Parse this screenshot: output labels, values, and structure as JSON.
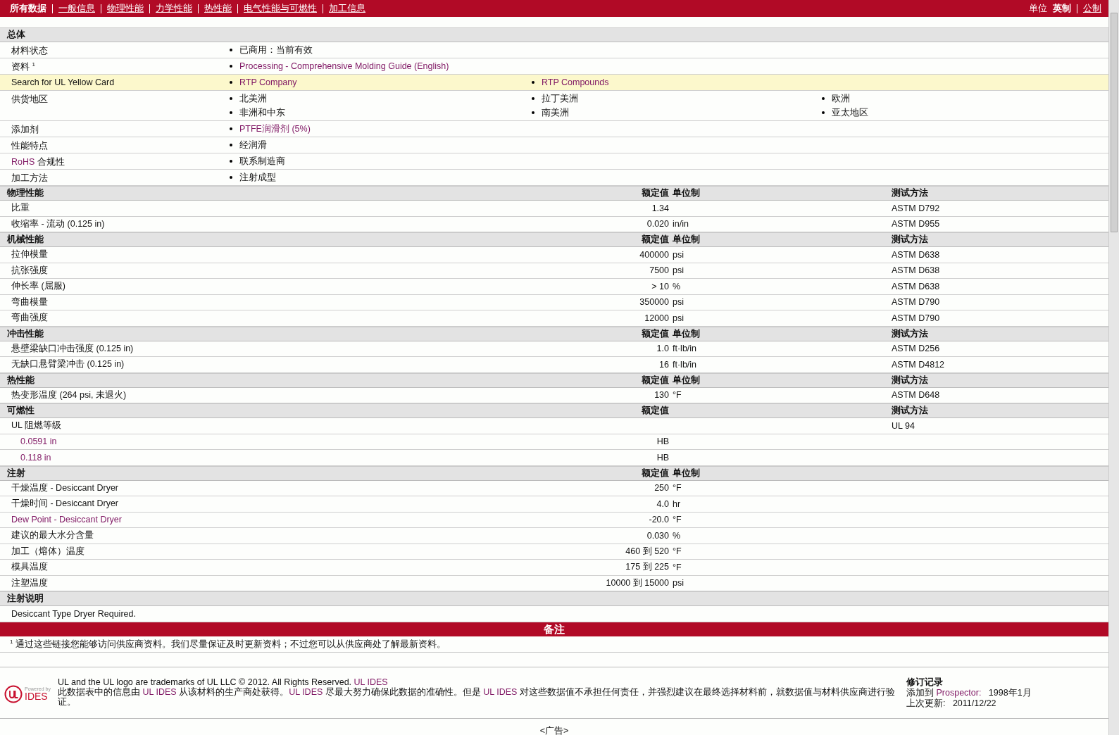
{
  "nav": {
    "tabs": [
      {
        "label": "所有数据",
        "selected": true
      },
      {
        "label": "一般信息",
        "selected": false
      },
      {
        "label": "物理性能",
        "selected": false
      },
      {
        "label": "力学性能",
        "selected": false
      },
      {
        "label": "热性能",
        "selected": false
      },
      {
        "label": "电气性能与可燃性",
        "selected": false
      },
      {
        "label": "加工信息",
        "selected": false
      }
    ],
    "units_label": "单位",
    "units": [
      {
        "label": "英制",
        "selected": true
      },
      {
        "label": "公制",
        "selected": false
      }
    ]
  },
  "general": {
    "title": "总体",
    "rows": [
      {
        "label": [
          {
            "text": "材料状态",
            "link": false
          }
        ],
        "highlighted": false,
        "items": [
          {
            "text": "已商用：当前有效",
            "link": false
          }
        ]
      },
      {
        "label": [
          {
            "text": "资料 $^{1}$",
            "link": false
          }
        ],
        "highlighted": false,
        "items": [
          {
            "text": "Processing - Comprehensive Molding Guide (English)",
            "link": true
          }
        ]
      },
      {
        "label": [
          {
            "text": "Search for UL Yellow Card",
            "link": false
          }
        ],
        "highlighted": true,
        "items": [
          {
            "text": "RTP Company",
            "link": true
          },
          {
            "text": "RTP Compounds",
            "link": true
          }
        ]
      },
      {
        "label": [
          {
            "text": "供货地区",
            "link": false
          }
        ],
        "highlighted": false,
        "items": [
          {
            "text": "北美洲",
            "link": false
          },
          {
            "text": "拉丁美洲",
            "link": false
          },
          {
            "text": "欧洲",
            "link": false
          },
          {
            "text": "非洲和中东",
            "link": false
          },
          {
            "text": "南美洲",
            "link": false
          },
          {
            "text": "亚太地区",
            "link": false
          }
        ]
      },
      {
        "label": [
          {
            "text": "添加剂",
            "link": false
          }
        ],
        "highlighted": false,
        "items": [
          {
            "text": "PTFE润滑剂  (5%)",
            "link": true
          }
        ]
      },
      {
        "label": [
          {
            "text": "性能特点",
            "link": false
          }
        ],
        "highlighted": false,
        "items": [
          {
            "text": "经润滑",
            "link": false
          }
        ]
      },
      {
        "label": [
          {
            "text": "RoHS",
            "link": true
          },
          {
            "text": "合规性",
            "link": false
          }
        ],
        "highlighted": false,
        "items": [
          {
            "text": "联系制造商",
            "link": false
          }
        ]
      },
      {
        "label": [
          {
            "text": "加工方法",
            "link": false
          }
        ],
        "highlighted": false,
        "items": [
          {
            "text": "注射成型",
            "link": false
          }
        ]
      }
    ]
  },
  "sections": [
    {
      "title": "物理性能",
      "value_header": "额定值",
      "unit_header": "单位制",
      "method_header": "测试方法",
      "rows": [
        {
          "name": "比重",
          "value": "1.34",
          "method": "ASTM D792"
        },
        {
          "name": "收缩率  - 流动  (0.125 in)",
          "value": "0.020",
          "unit": "in/in",
          "method": "ASTM D955"
        }
      ]
    },
    {
      "title": "机械性能",
      "value_header": "额定值",
      "unit_header": "单位制",
      "method_header": "测试方法",
      "rows": [
        {
          "name": "拉伸模量",
          "value": "400000",
          "unit": "psi",
          "method": "ASTM D638"
        },
        {
          "name": "抗张强度",
          "value": "7500",
          "unit": "psi",
          "method": "ASTM D638"
        },
        {
          "name": "伸长率  (屈服)",
          "value": "> 10",
          "unit": "%",
          "method": "ASTM D638"
        },
        {
          "name": "弯曲模量",
          "value": "350000",
          "unit": "psi",
          "method": "ASTM D790"
        },
        {
          "name": "弯曲强度",
          "value": "12000",
          "unit": "psi",
          "method": "ASTM D790"
        }
      ]
    },
    {
      "title": "冲击性能",
      "value_header": "额定值",
      "unit_header": "单位制",
      "method_header": "测试方法",
      "rows": [
        {
          "name": "悬壁梁缺口冲击强度  (0.125 in)",
          "value": "1.0",
          "unit": "ft·lb/in",
          "method": "ASTM D256"
        },
        {
          "name": "无缺口悬臂梁冲击  (0.125 in)",
          "value": "16",
          "unit": "ft·lb/in",
          "method": "ASTM D4812"
        }
      ]
    },
    {
      "title": "热性能",
      "value_header": "额定值",
      "unit_header": "单位制",
      "method_header": "测试方法",
      "rows": [
        {
          "name": "热变形温度  (264 psi, 未退火)",
          "value": "130",
          "unit": "°F",
          "method": "ASTM D648"
        }
      ]
    },
    {
      "title": "可燃性",
      "value_header": "额定值",
      "method_header": "测试方法",
      "rows": [
        {
          "name": "UL 阻燃等级",
          "method": "UL 94",
          "children": [
            {
              "name": "0.0591 in",
              "value": "HB",
              "link": true
            },
            {
              "name": "0.118 in",
              "value": "HB",
              "link": true
            }
          ]
        }
      ]
    },
    {
      "title": "注射",
      "value_header": "额定值",
      "unit_header": "单位制",
      "rows": [
        {
          "name": "干燥温度  - Desiccant Dryer",
          "value": "250",
          "unit": "°F"
        },
        {
          "name": "干燥时间  - Desiccant Dryer",
          "value": "4.0",
          "unit": "hr"
        },
        {
          "name": "Dew Point - Desiccant Dryer",
          "value": "-20.0",
          "unit": "°F",
          "link": true
        },
        {
          "name": "建议的最大水分含量",
          "value": "0.030",
          "unit": "%"
        },
        {
          "name": "加工（熔体）温度",
          "value": "460 到  520",
          "unit": "°F"
        },
        {
          "name": "模具温度",
          "value": "175 到  225",
          "unit": "°F"
        },
        {
          "name": "注塑温度",
          "value": "10000 到  15000",
          "unit": "psi"
        }
      ]
    },
    {
      "title": "注射说明",
      "rows": [
        {
          "name": "Desiccant Type Dryer Required."
        }
      ]
    }
  ],
  "notes": {
    "title": "备注",
    "footnote": "$^{1}$ 通过这些链接您能够访问供应商资料。我们尽量保证及时更新资料；不过您可以从供应商处了解最新资料。"
  },
  "footer": {
    "logo": {
      "powered": "Powered by",
      "brand": "IDES"
    },
    "line1": [
      {
        "text": "UL and the UL logo are trademarks of UL LLC © 2012. All Rights Reserved. ",
        "link": false
      },
      {
        "text": "UL IDES",
        "link": true
      }
    ],
    "line2": [
      {
        "text": "此数据表中的信息由 ",
        "link": false
      },
      {
        "text": "UL IDES",
        "link": true
      },
      {
        "text": " 从该材料的生产商处获得。",
        "link": false
      },
      {
        "text": "UL IDES",
        "link": true
      },
      {
        "text": " 尽最大努力确保此数据的准确性。但是 ",
        "link": false
      },
      {
        "text": "UL IDES",
        "link": true
      },
      {
        "text": " 对这些数据值不承担任何责任，并强烈建议在最终选择材料前，就数据值与材料供应商进行验证。",
        "link": false
      }
    ],
    "revision": {
      "title": "修订记录",
      "rows": [
        {
          "label": "添加到",
          "link": "Prospector:",
          "value": "1998年1月"
        },
        {
          "label": "上次更新:",
          "value": "2011/12/22"
        }
      ]
    }
  },
  "ad": "<广告>"
}
